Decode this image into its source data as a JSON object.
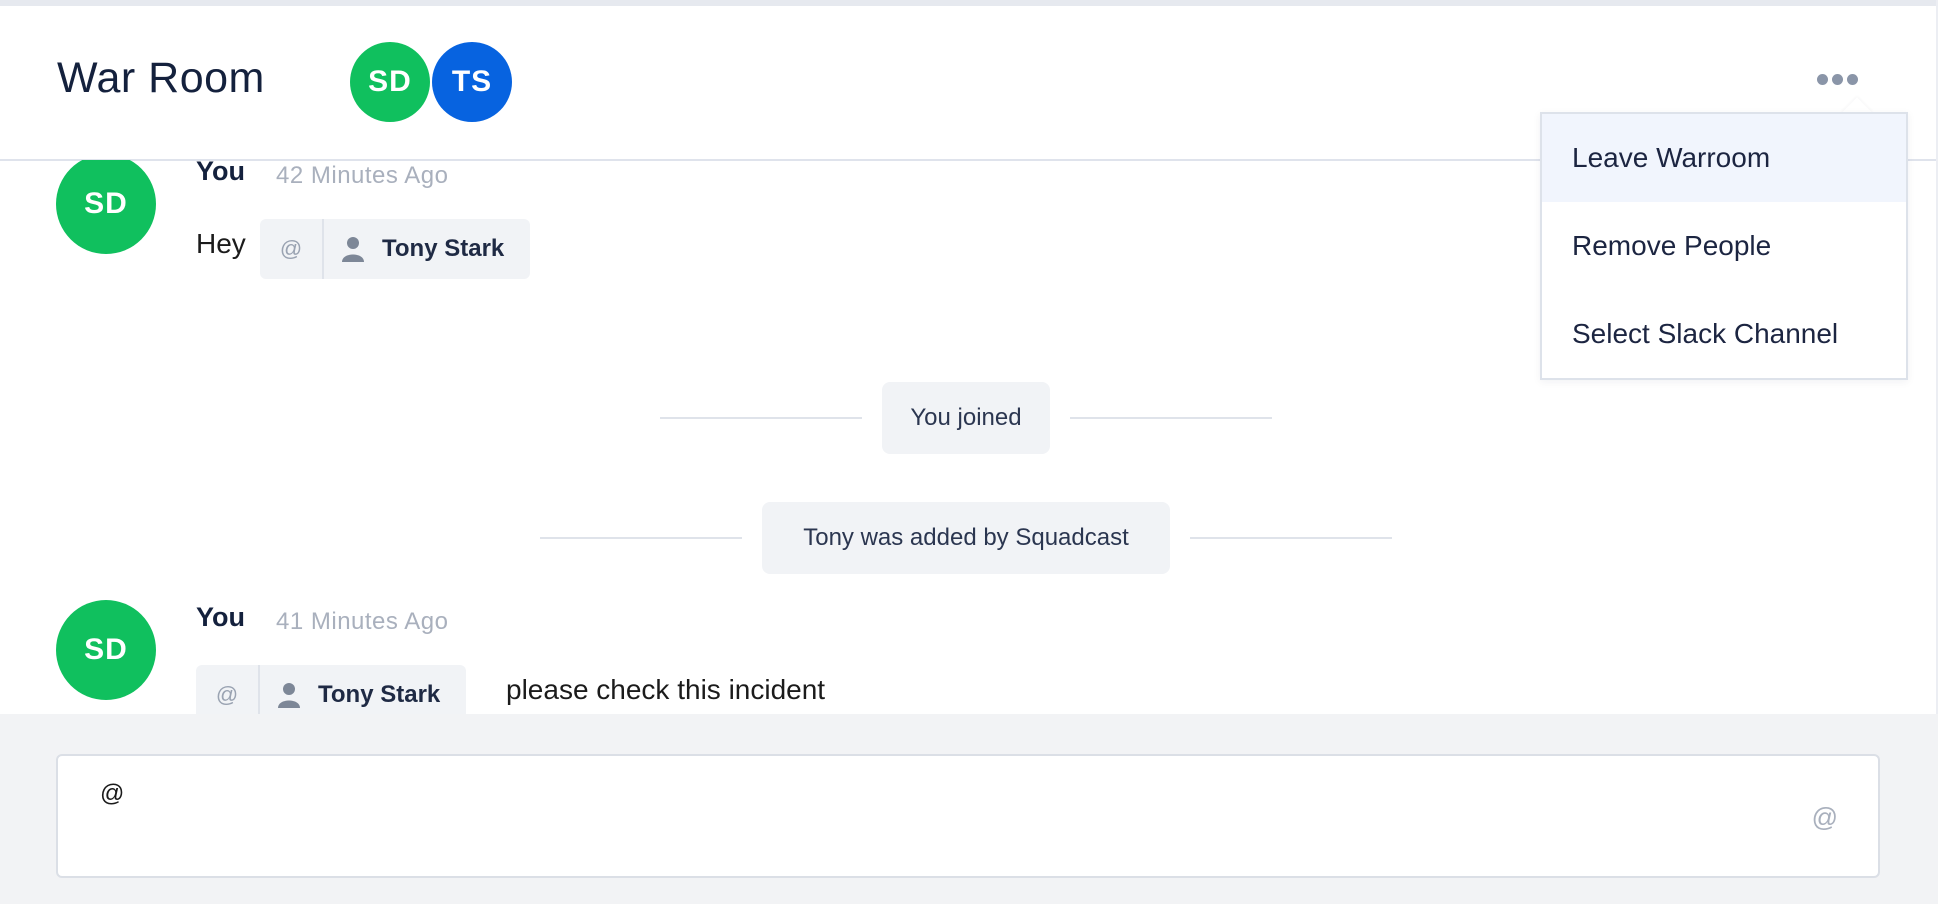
{
  "header": {
    "title": "War Room",
    "participants": [
      {
        "initials": "SD",
        "color": "#10c05e"
      },
      {
        "initials": "TS",
        "color": "#0763e0"
      }
    ]
  },
  "messages": [
    {
      "avatar": "SD",
      "author": "You",
      "time": "42 Minutes Ago",
      "text": "Hey",
      "mention": {
        "at": "@",
        "name": "Tony Stark"
      }
    },
    {
      "avatar": "SD",
      "author": "You",
      "time": "41 Minutes Ago",
      "text": "please check this incident",
      "mention": {
        "at": "@",
        "name": "Tony Stark"
      }
    }
  ],
  "system_events": [
    {
      "text": "You joined"
    },
    {
      "text": "Tony was added by Squadcast"
    }
  ],
  "menu": {
    "items": [
      {
        "label": "Leave Warroom"
      },
      {
        "label": "Remove People"
      },
      {
        "label": "Select Slack Channel"
      }
    ]
  },
  "composer": {
    "value": "@",
    "mention_icon": "@"
  },
  "colors": {
    "avatar_green": "#10c05e",
    "avatar_blue": "#0763e0",
    "menu_hover": "#f1f5fd"
  }
}
